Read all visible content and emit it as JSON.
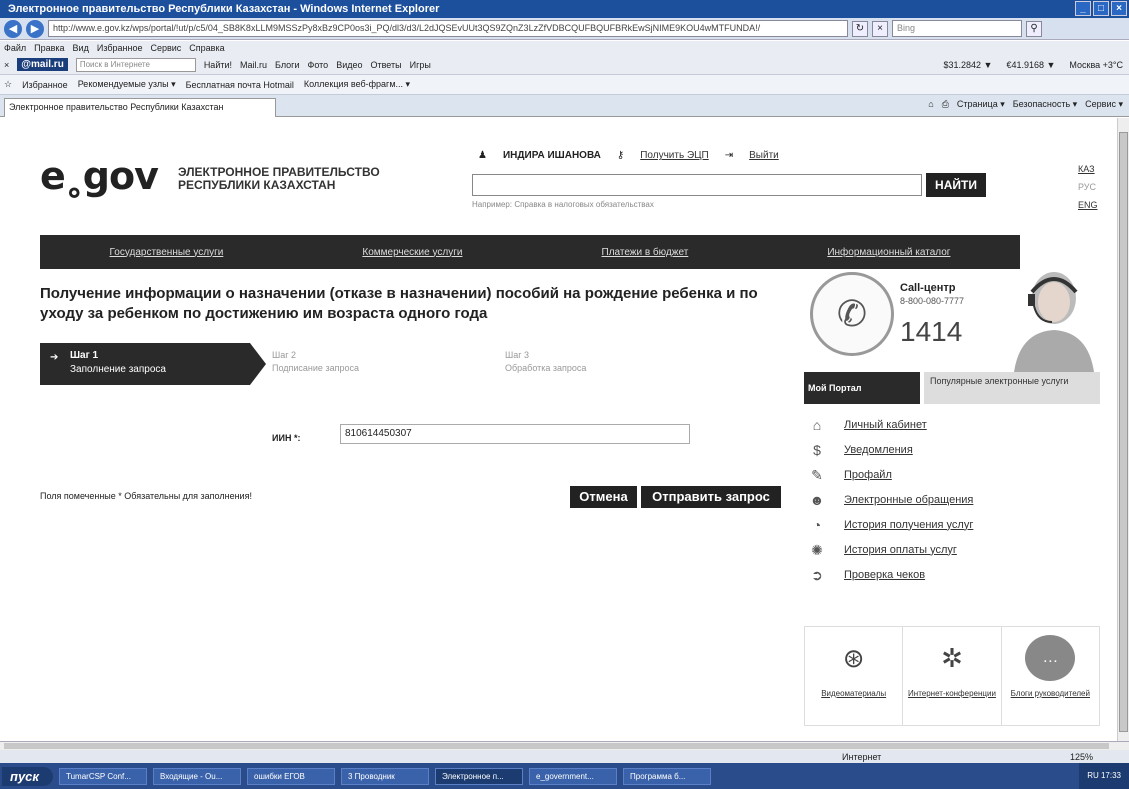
{
  "window": {
    "title": "Электронное правительство Республики Казахстан - Windows Internet Explorer",
    "url": "http://www.e.gov.kz/wps/portal/!ut/p/c5/04_SB8K8xLLM9MSSzPy8xBz9CP0os3i_PQ/dl3/d3/L2dJQSEvUUt3QS9ZQnZ3LzZfVDBCQUFBQUFBRkEwSjNIME9KOU4wMTFUNDA!/",
    "search_placeholder": "Bing",
    "menu": [
      "Файл",
      "Правка",
      "Вид",
      "Избранное",
      "Сервис",
      "Справка"
    ]
  },
  "mailbar": {
    "logo": "@mail.ru",
    "search_placeholder": "Поиск в Интернете",
    "items": [
      "Найти!",
      "Mail.ru",
      "Блоги",
      "Фото",
      "Видео",
      "Ответы",
      "Игры"
    ],
    "usd": "$31.2842 ▼",
    "eur": "€41.9168 ▼",
    "weather": "Москва +3°C"
  },
  "favbar": {
    "label": "Избранное",
    "items": [
      "Рекомендуемые узлы ▾",
      "Бесплатная почта Hotmail",
      "Коллекция веб-фрагм... ▾"
    ]
  },
  "tabs": {
    "active": "Электронное правительство Республики Казахстан",
    "commands": [
      "Страница ▾",
      "Безопасность ▾",
      "Сервис ▾"
    ]
  },
  "header": {
    "logo": "e˳gov",
    "tagline_1": "ЭЛЕКТРОННОЕ ПРАВИТЕЛЬСТВО",
    "tagline_2": "РЕСПУБЛИКИ КАЗАХСТАН",
    "user": "ИНДИРА ИШАНОВА",
    "get_eds": "Получить ЭЦП",
    "logout": "Выйти",
    "search_hint": "Например: Справка в налоговых обязательствах",
    "find_button": "НАЙТИ",
    "langs": [
      "КАЗ",
      "РУС",
      "ENG"
    ]
  },
  "nav": [
    "Государственные услуги",
    "Коммерческие услуги",
    "Платежи в бюджет",
    "Информационный каталог"
  ],
  "page": {
    "title": "Получение информации о назначении (отказе в назначении) пособий на рождение ребенка и по уходу за ребенком по достижению им возраста одного года",
    "steps": [
      {
        "num": "Шаг 1",
        "label": "Заполнение запроса"
      },
      {
        "num": "Шаг 2",
        "label": "Подписание запроса"
      },
      {
        "num": "Шаг 3",
        "label": "Обработка запроса"
      }
    ],
    "iin_label": "ИИН *:",
    "iin_value": "810614450307",
    "required_note": "Поля помеченные * Обязательны для заполнения!",
    "cancel": "Отмена",
    "submit": "Отправить запрос"
  },
  "sidebar": {
    "cc_title": "Call-центр",
    "cc_phone": "8-800-080-7777",
    "cc_short": "1414",
    "tab_portal": "Мой Портал",
    "tab_popular": "Популярные электронные услуги",
    "items": [
      "Личный кабинет",
      "Уведомления",
      "Профайл",
      "Электронные обращения",
      "История получения услуг",
      "История оплаты услуг",
      "Проверка чеков"
    ],
    "media": [
      "Видеоматериалы",
      "Интернет-конференции",
      "Блоги руководителей"
    ]
  },
  "status": {
    "zone": "Интернет",
    "zoom": "125%"
  },
  "taskbar": {
    "start": "пуск",
    "items": [
      "TumarCSP Conf...",
      "Входящие - Ou...",
      "ошибки ЕГОВ",
      "3 Проводник",
      "Электронное п...",
      "e_government...",
      "Программа б..."
    ],
    "clock": "RU 17:33"
  }
}
